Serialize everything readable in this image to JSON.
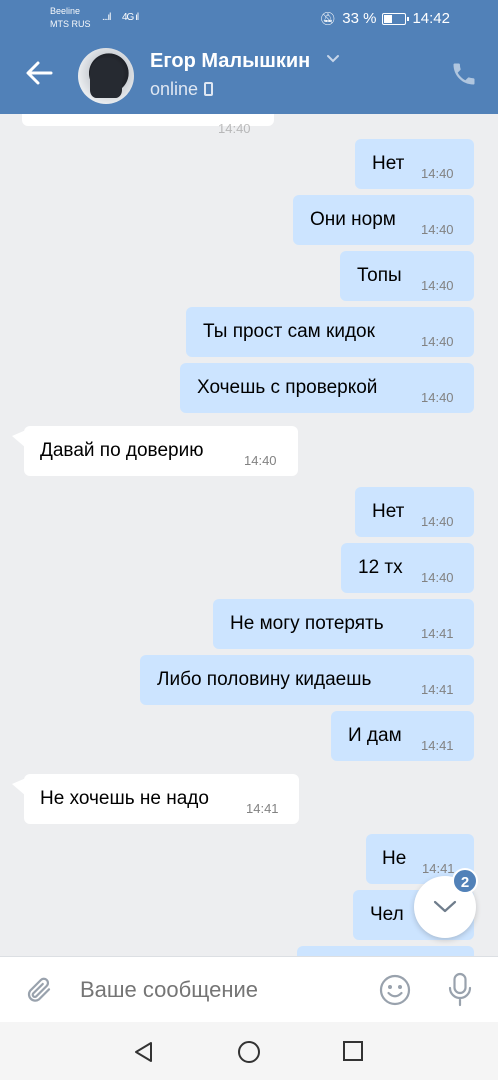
{
  "status_bar": {
    "carrier1": "Beeline",
    "carrier2": "MTS RUS",
    "signal1": "...ıl",
    "signal2": "4G ıl",
    "battery": "33 %",
    "time": "14:42"
  },
  "header": {
    "contact_name": "Егор Малышкин",
    "status": "online"
  },
  "messages": [
    {
      "dir": "in",
      "text": "",
      "time": "14:40",
      "partial": true
    },
    {
      "dir": "out",
      "text": "Нет",
      "time": "14:40"
    },
    {
      "dir": "out",
      "text": "Они норм",
      "time": "14:40"
    },
    {
      "dir": "out",
      "text": "Топы",
      "time": "14:40"
    },
    {
      "dir": "out",
      "text": "Ты прост сам кидок",
      "time": "14:40"
    },
    {
      "dir": "out",
      "text": "Хочешь с проверкой",
      "time": "14:40"
    },
    {
      "dir": "in",
      "text": "Давай по доверию",
      "time": "14:40"
    },
    {
      "dir": "out",
      "text": "Нет",
      "time": "14:40"
    },
    {
      "dir": "out",
      "text": "12 тх",
      "time": "14:40"
    },
    {
      "dir": "out",
      "text": "Не могу потерять",
      "time": "14:41"
    },
    {
      "dir": "out",
      "text": "Либо половину кидаешь",
      "time": "14:41"
    },
    {
      "dir": "out",
      "text": "И дам",
      "time": "14:41"
    },
    {
      "dir": "in",
      "text": "Не хочешь не надо",
      "time": "14:41"
    },
    {
      "dir": "out",
      "text": "Не",
      "time": "14:41"
    },
    {
      "dir": "out",
      "text": "Чел",
      "time": ""
    },
    {
      "dir": "out",
      "text": "",
      "time": "",
      "partial": true
    }
  ],
  "scroll_down": {
    "unread_count": "2"
  },
  "composer": {
    "placeholder": "Ваше сообщение"
  },
  "colors": {
    "accent": "#5181b8",
    "outgoing_bubble": "#cce4ff",
    "incoming_bubble": "#ffffff",
    "background": "#edeef0"
  },
  "icons": [
    "back-arrow-icon",
    "chevron-down-icon",
    "mobile-icon",
    "phone-icon",
    "attach-icon",
    "smile-icon",
    "microphone-icon",
    "chevron-down-icon",
    "nav-back-icon",
    "nav-home-icon",
    "nav-recent-icon"
  ]
}
